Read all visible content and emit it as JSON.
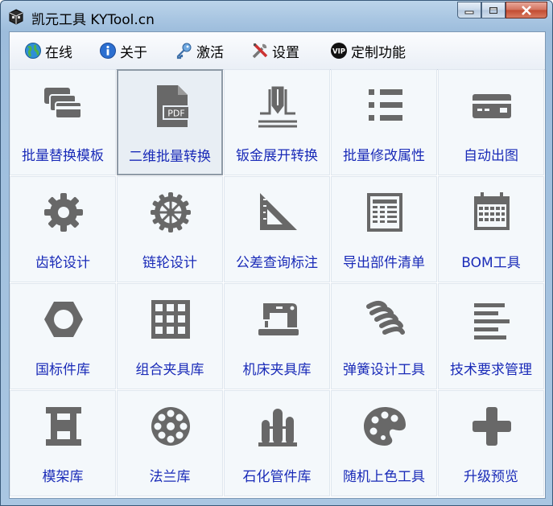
{
  "window": {
    "title": "凯元工具 KYTool.cn"
  },
  "menu": [
    {
      "label": "在线",
      "icon": "globe-icon"
    },
    {
      "label": "关于",
      "icon": "info-icon"
    },
    {
      "label": "激活",
      "icon": "key-icon"
    },
    {
      "label": "设置",
      "icon": "tools-icon"
    },
    {
      "label": "定制功能",
      "icon": "vip-icon"
    }
  ],
  "tiles": [
    {
      "label": "批量替换模板",
      "icon": "cards-stack-icon"
    },
    {
      "label": "二维批量转换",
      "icon": "pdf-file-icon"
    },
    {
      "label": "钣金展开转换",
      "icon": "sheet-metal-icon"
    },
    {
      "label": "批量修改属性",
      "icon": "list-icon"
    },
    {
      "label": "自动出图",
      "icon": "drawing-card-icon"
    },
    {
      "label": "齿轮设计",
      "icon": "gear-icon"
    },
    {
      "label": "链轮设计",
      "icon": "sprocket-icon"
    },
    {
      "label": "公差查询标注",
      "icon": "triangle-ruler-icon"
    },
    {
      "label": "导出部件清单",
      "icon": "table-sheet-icon"
    },
    {
      "label": "BOM工具",
      "icon": "calendar-table-icon"
    },
    {
      "label": "国标件库",
      "icon": "hex-nut-icon"
    },
    {
      "label": "组合夹具库",
      "icon": "grid-block-icon"
    },
    {
      "label": "机床夹具库",
      "icon": "sewing-machine-icon"
    },
    {
      "label": "弹簧设计工具",
      "icon": "spring-icon"
    },
    {
      "label": "技术要求管理",
      "icon": "text-lines-icon"
    },
    {
      "label": "模架库",
      "icon": "mold-base-icon"
    },
    {
      "label": "法兰库",
      "icon": "flange-icon"
    },
    {
      "label": "石化管件库",
      "icon": "petrochemical-icon"
    },
    {
      "label": "随机上色工具",
      "icon": "palette-icon"
    },
    {
      "label": "升级预览",
      "icon": "plus-icon"
    }
  ],
  "selected_tile": "二维批量转换"
}
